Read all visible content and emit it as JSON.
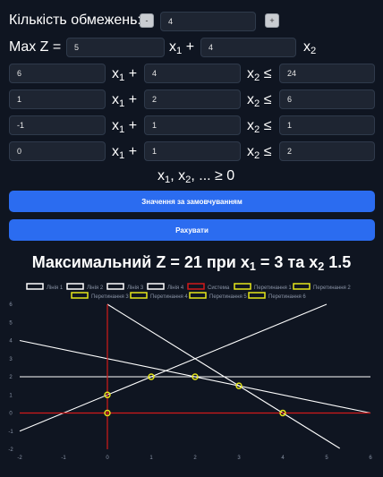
{
  "constraints_count": {
    "label": "Кількість обмежень:",
    "minus": "-",
    "value": "4",
    "plus": "+"
  },
  "objective": {
    "label": "Max Z =",
    "c1": "5",
    "x1": "x",
    "x1_sub": "1",
    "plus": "+",
    "c2": "4",
    "x2": "x",
    "x2_sub": "2"
  },
  "constraints": [
    {
      "a": "6",
      "b": "4",
      "rhs": "24"
    },
    {
      "a": "1",
      "b": "2",
      "rhs": "6"
    },
    {
      "a": "-1",
      "b": "1",
      "rhs": "1"
    },
    {
      "a": "0",
      "b": "1",
      "rhs": "2"
    }
  ],
  "constraint_text": {
    "x1": "x",
    "x1_sub": "1",
    "plus": "+",
    "x2": "x",
    "x2_sub": "2",
    "leq": "≤"
  },
  "nonneg": {
    "text_x1": "x",
    "sub1": "1",
    "text_x2": ", x",
    "sub2": "2",
    "rest": ", ... ≥ 0"
  },
  "buttons": {
    "default": "Значення за замовчуванням",
    "calculate": "Рахувати"
  },
  "result": {
    "prefix": "Максимальний Z = 21 при x",
    "sub1": "1",
    "mid": " = 3 та x",
    "sub2": "2",
    "suffix": " 1.5"
  },
  "colors": {
    "background": "#0f1521",
    "button": "#2b6cf0",
    "line": "#ffffff",
    "system": "#d11a1a",
    "intersection": "#e6e61a"
  },
  "chart_data": {
    "type": "line",
    "legend_placement": "top",
    "xlim": [
      -2,
      6
    ],
    "ylim": [
      -2,
      6
    ],
    "xticks": [
      "-2",
      "-1",
      "0",
      "1",
      "2",
      "3",
      "4",
      "5",
      "6"
    ],
    "yticks": [
      "-2",
      "-1",
      "0",
      "1",
      "2",
      "3",
      "4",
      "5",
      "6"
    ],
    "series": [
      {
        "name": "Лінія 1",
        "color": "#ffffff",
        "x": [
          0,
          5.3
        ],
        "y": [
          6,
          -1.95
        ]
      },
      {
        "name": "Лінія 2",
        "color": "#ffffff",
        "x": [
          -2,
          6
        ],
        "y": [
          4,
          0
        ]
      },
      {
        "name": "Лінія 3",
        "color": "#ffffff",
        "x": [
          -2,
          5
        ],
        "y": [
          -1,
          6
        ]
      },
      {
        "name": "Лінія 4",
        "color": "#ffffff",
        "x": [
          -2,
          6
        ],
        "y": [
          2,
          2
        ]
      },
      {
        "name": "Система",
        "color": "#d11a1a",
        "segments": [
          [
            [
              0,
              -2
            ],
            [
              0,
              6
            ]
          ],
          [
            [
              -2,
              0
            ],
            [
              6,
              0
            ]
          ]
        ]
      }
    ],
    "intersections": [
      {
        "name": "Перетинання 1",
        "x": 0,
        "y": 1
      },
      {
        "name": "Перетинання 2",
        "x": 1,
        "y": 2
      },
      {
        "name": "Перетинання 3",
        "x": 2,
        "y": 2
      },
      {
        "name": "Перетинання 4",
        "x": 3,
        "y": 1.5
      },
      {
        "name": "Перетинання 5",
        "x": 0,
        "y": 0
      },
      {
        "name": "Перетинання 6",
        "x": 4,
        "y": 0
      }
    ]
  }
}
